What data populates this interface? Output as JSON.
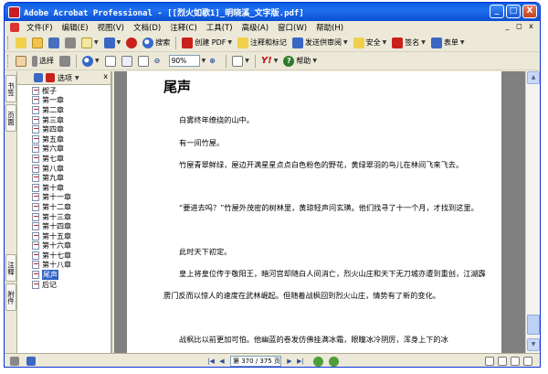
{
  "window": {
    "title": "Adobe Acrobat Professional - [[烈火如歌1]_明晓溪_文字版.pdf]",
    "controls": {
      "minimize": "_",
      "maximize": "□",
      "close": "X"
    }
  },
  "menu": {
    "items": [
      "文件(F)",
      "编辑(E)",
      "视图(V)",
      "文档(D)",
      "注释(C)",
      "工具(T)",
      "高级(A)",
      "窗口(W)",
      "帮助(H)"
    ],
    "mdi_controls": {
      "minimize": "_",
      "restore": "◻",
      "close": "x"
    }
  },
  "toolbar1": {
    "search_label": "搜索",
    "create_pdf_label": "创建 PDF",
    "comment_label": "注释和标记",
    "send_review_label": "发送供审阅",
    "security_label": "安全",
    "sign_label": "签名",
    "forms_label": "表单"
  },
  "toolbar2": {
    "select_label": "选择",
    "zoom_value": "90%",
    "help_label": "帮助",
    "yahoo_label": "Y!"
  },
  "bookmarks": {
    "options_label": "选项",
    "close_symbol": "x",
    "items": [
      "楔子",
      "第一章",
      "第二章",
      "第三章",
      "第四章",
      "第五章",
      "第六章",
      "第七章",
      "第八章",
      "第九章",
      "第十章",
      "第十一章",
      "第十二章",
      "第十三章",
      "第十四章",
      "第十五章",
      "第十六章",
      "第十七章",
      "第十八章",
      "尾声",
      "后记"
    ],
    "selected": "尾声"
  },
  "left_tabs": [
    "书签",
    "页面",
    "注释",
    "附件"
  ],
  "document": {
    "title": "尾声",
    "paragraphs": [
      "白雾终年缭绕的山中。",
      "有一间竹屋。",
      "竹屋青翠鲜绿，屋边开满星星点点白色粉色的野花，黄绿翠羽的鸟儿在林间飞来飞去。",
      "“要进去吗？”竹屋外茂密的树林里，黄琼轻声问玄璜。他们找寻了十一个月，才找到这里。",
      "此时天下初定。",
      "皇上将皇位传于敬阳王，暗河宫却随白人间消亡，烈火山庄和天下无刀城亦遭到重创，江湖霹雳门反而以惊人的速度在武林崛起。但随着战枫回到烈火山庄，情势有了新的变化。",
      "战枫比以前更加可怕。他幽蓝的卷发仿佛挂满冰霜，眼瞳冰冷阴厉，浑身上下的冰"
    ]
  },
  "statusbar": {
    "page_display": "第 370 / 375 页",
    "first": "|◀",
    "prev": "◀",
    "next": "▶",
    "last": "▶|"
  }
}
